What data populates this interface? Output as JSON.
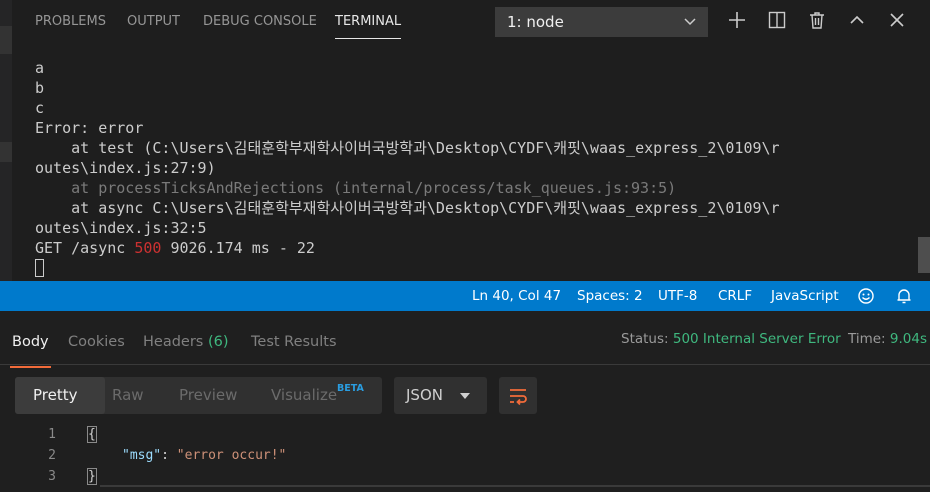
{
  "vscode": {
    "panel_tabs": [
      "PROBLEMS",
      "OUTPUT",
      "DEBUG CONSOLE",
      "TERMINAL"
    ],
    "active_tab": "TERMINAL",
    "terminal_select": "1: node",
    "toolbar_icons": [
      "add-icon",
      "split-icon",
      "trash-icon",
      "chevron-up-icon",
      "close-icon"
    ],
    "terminal": {
      "line1": "a",
      "line2": "b",
      "line3": "c",
      "line4": "Error: error",
      "line5": "    at test (C:\\Users\\김태훈학부재학사이버국방학과\\Desktop\\CYDF\\캐핏\\waas_express_2\\0109\\r",
      "line6": "outes\\index.js:27:9)",
      "line7": "    at processTicksAndRejections (internal/process/task_queues.js:93:5)",
      "line8": "    at async C:\\Users\\김태훈학부재학사이버국방학과\\Desktop\\CYDF\\캐핏\\waas_express_2\\0109\\r",
      "line9": "outes\\index.js:32:5",
      "line10_prefix": "GET /async ",
      "line10_status": "500",
      "line10_suffix": " 9026.174 ms - 22"
    }
  },
  "status_bar": {
    "position": "Ln 40, Col 47",
    "spaces": "Spaces: 2",
    "encoding": "UTF-8",
    "eol": "CRLF",
    "language": "JavaScript",
    "icons": [
      "smiley-icon",
      "bell-icon"
    ],
    "color": "#007acc"
  },
  "postman": {
    "tabs": {
      "body": "Body",
      "cookies": "Cookies",
      "headers": "Headers",
      "headers_count": "(6)",
      "tests": "Test Results"
    },
    "status_label": "Status:",
    "status_value": "500 Internal Server Error",
    "time_label": "Time:",
    "time_value": "9.04s",
    "views": [
      "Pretty",
      "Raw",
      "Preview",
      "Visualize"
    ],
    "beta": "BETA",
    "format": "JSON",
    "accent": "#f26b3a",
    "code": {
      "line_numbers": [
        "1",
        "2",
        "3"
      ],
      "open": "{",
      "key": "\"msg\"",
      "colon": ": ",
      "value": "\"error occur!\"",
      "close": "}"
    }
  }
}
